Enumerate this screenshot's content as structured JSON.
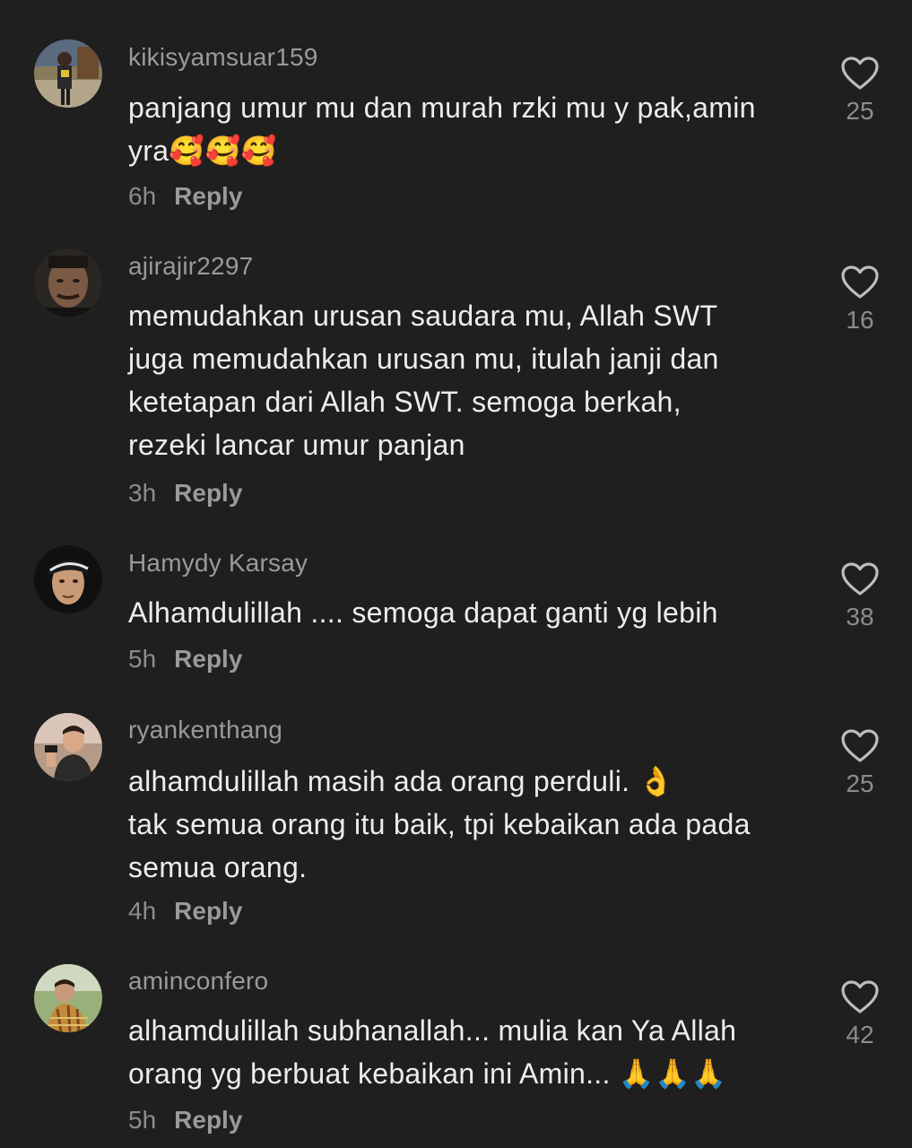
{
  "colors": {
    "background": "#1f1f1f",
    "username": "#9a9a9a",
    "text": "#ededed",
    "meta": "#8c8c8c",
    "heart_outline": "#bdbdbd"
  },
  "comments": [
    {
      "username": "kikisyamsuar159",
      "text": "panjang umur mu dan murah rzki mu y pak,amin\nyra🥰🥰🥰",
      "time": "6h",
      "reply_label": "Reply",
      "likes": "25"
    },
    {
      "username": "ajirajir2297",
      "text": "memudahkan urusan saudara mu, Allah SWT\njuga memudahkan urusan mu, itulah janji dan\nketetapan dari Allah SWT. semoga berkah,\nrezeki lancar umur panjan",
      "time": "3h",
      "reply_label": "Reply",
      "likes": "16"
    },
    {
      "username": "Hamydy Karsay",
      "text": "Alhamdulillah .... semoga dapat ganti yg lebih",
      "time": "5h",
      "reply_label": "Reply",
      "likes": "38"
    },
    {
      "username": "ryankenthang",
      "text": "alhamdulillah masih ada orang perduli. 👌\ntak semua orang itu baik, tpi kebaikan ada pada\nsemua orang.",
      "time": "4h",
      "reply_label": "Reply",
      "likes": "25"
    },
    {
      "username": "aminconfero",
      "text": "alhamdulillah subhanallah... mulia kan Ya Allah\norang yg berbuat kebaikan ini Amin... 🙏🙏🙏",
      "time": "5h",
      "reply_label": "Reply",
      "likes": "42"
    }
  ]
}
